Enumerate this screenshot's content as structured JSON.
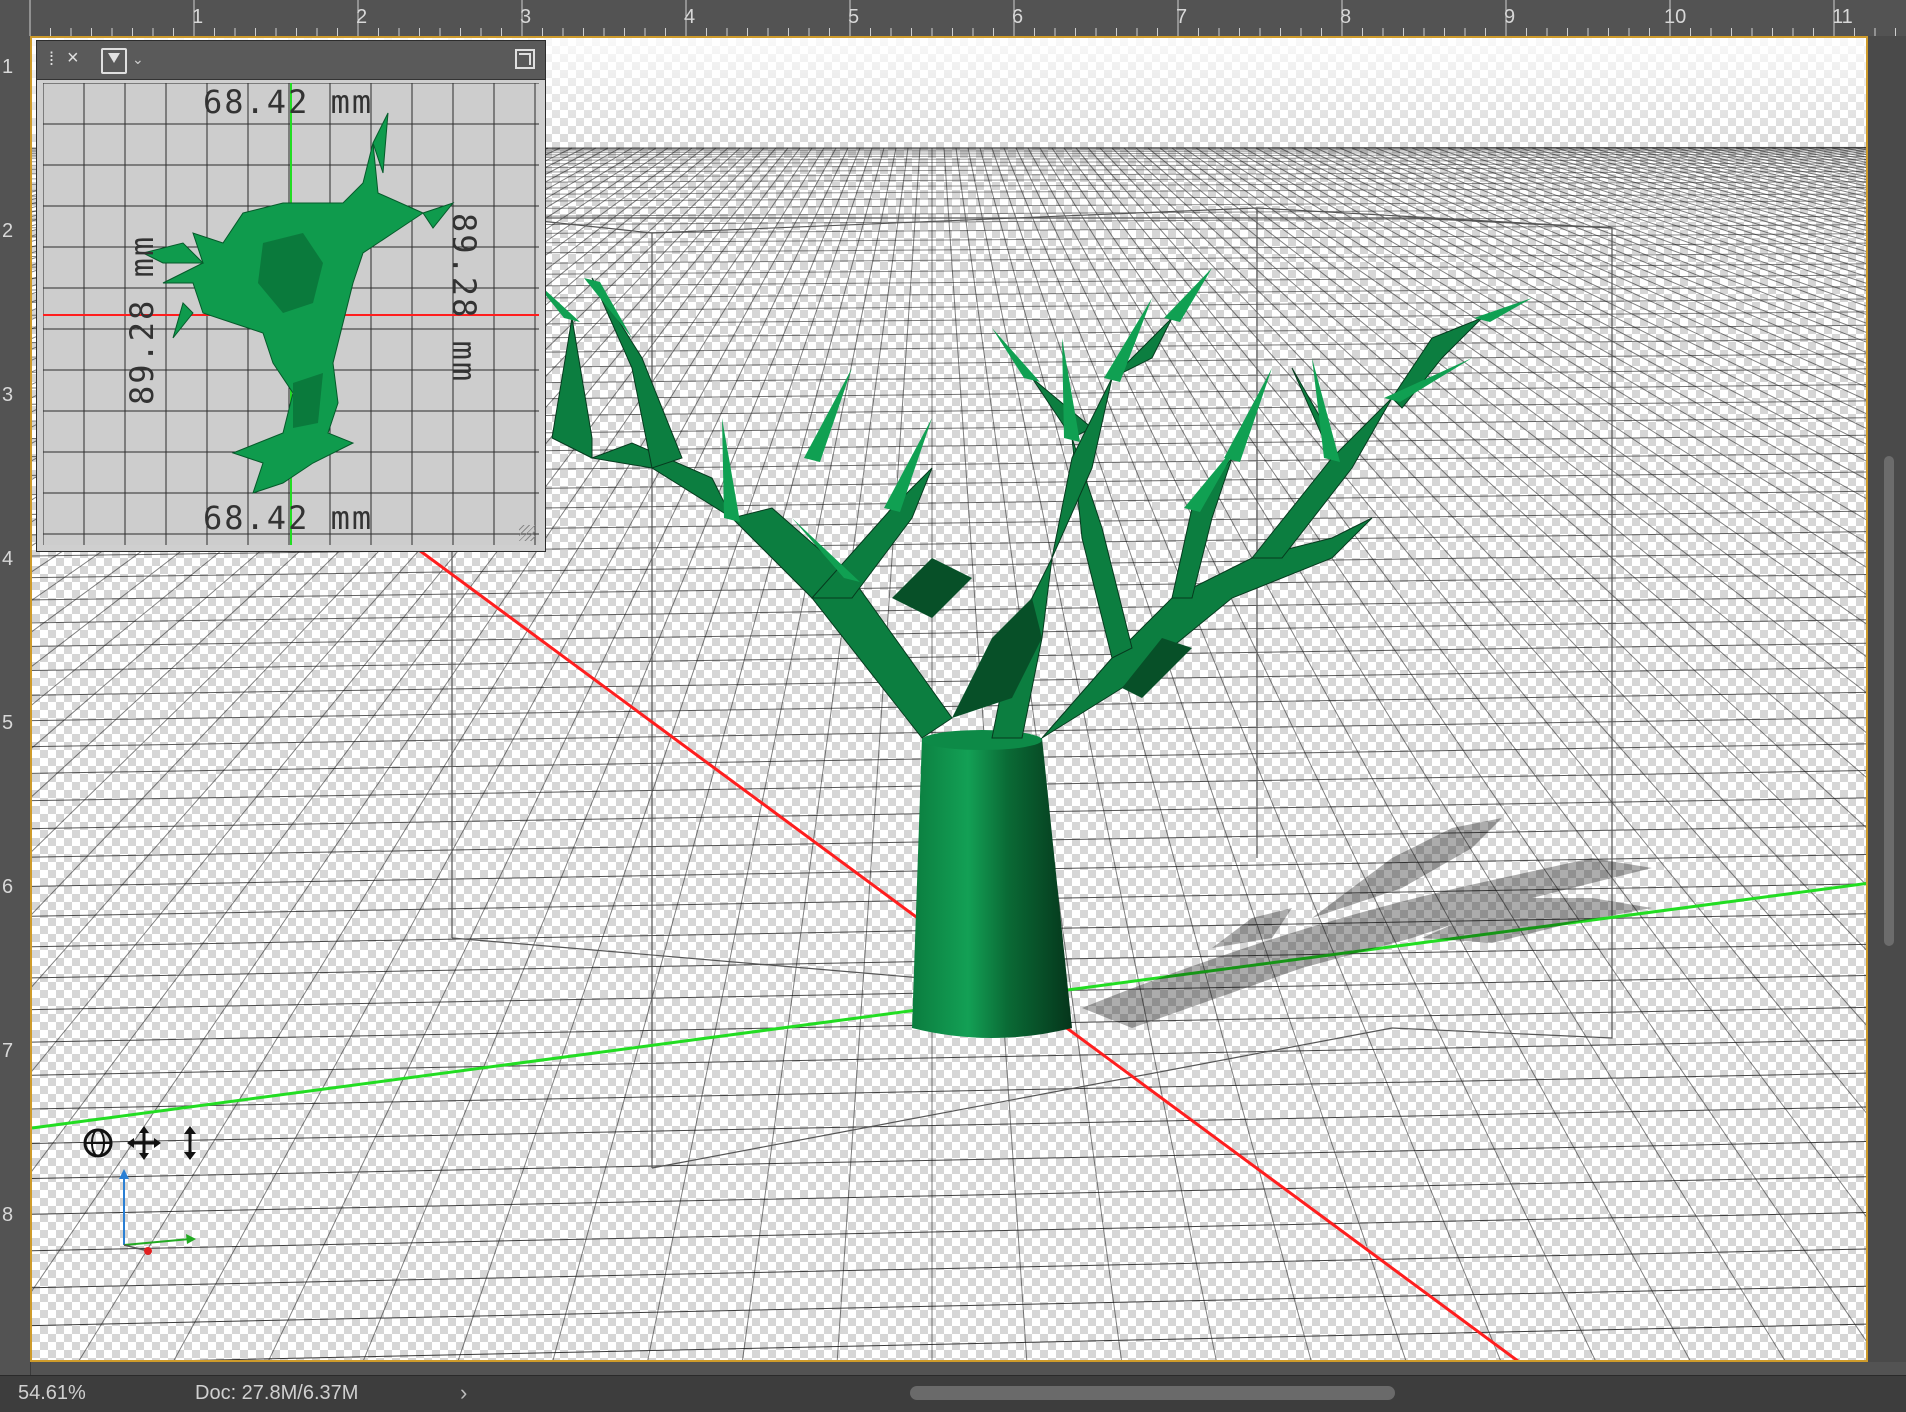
{
  "ruler": {
    "top_labels": [
      "1",
      "2",
      "3",
      "4",
      "5",
      "6",
      "7",
      "8",
      "9",
      "10",
      "11"
    ],
    "left_labels": [
      "1",
      "2",
      "3",
      "4",
      "5",
      "6",
      "7",
      "8"
    ]
  },
  "panel": {
    "dimension_top": "68.42 mm",
    "dimension_bottom": "68.42 mm",
    "dimension_left": "89.28 mm",
    "dimension_right": "89.28 mm"
  },
  "status": {
    "zoom": "54.61%",
    "doc": "Doc: 27.8M/6.37M",
    "arrow": "›"
  },
  "icons": {
    "orbit": "orbit-3d-icon",
    "pan": "pan-3d-icon",
    "dolly": "dolly-3d-icon",
    "axis": "axis-widget-icon"
  },
  "colors": {
    "x_axis": "#ff1e1e",
    "y_axis": "#22dd22",
    "tree": "#0d8a47",
    "tree_dark": "#064023",
    "selection": "#ce9b2b"
  }
}
